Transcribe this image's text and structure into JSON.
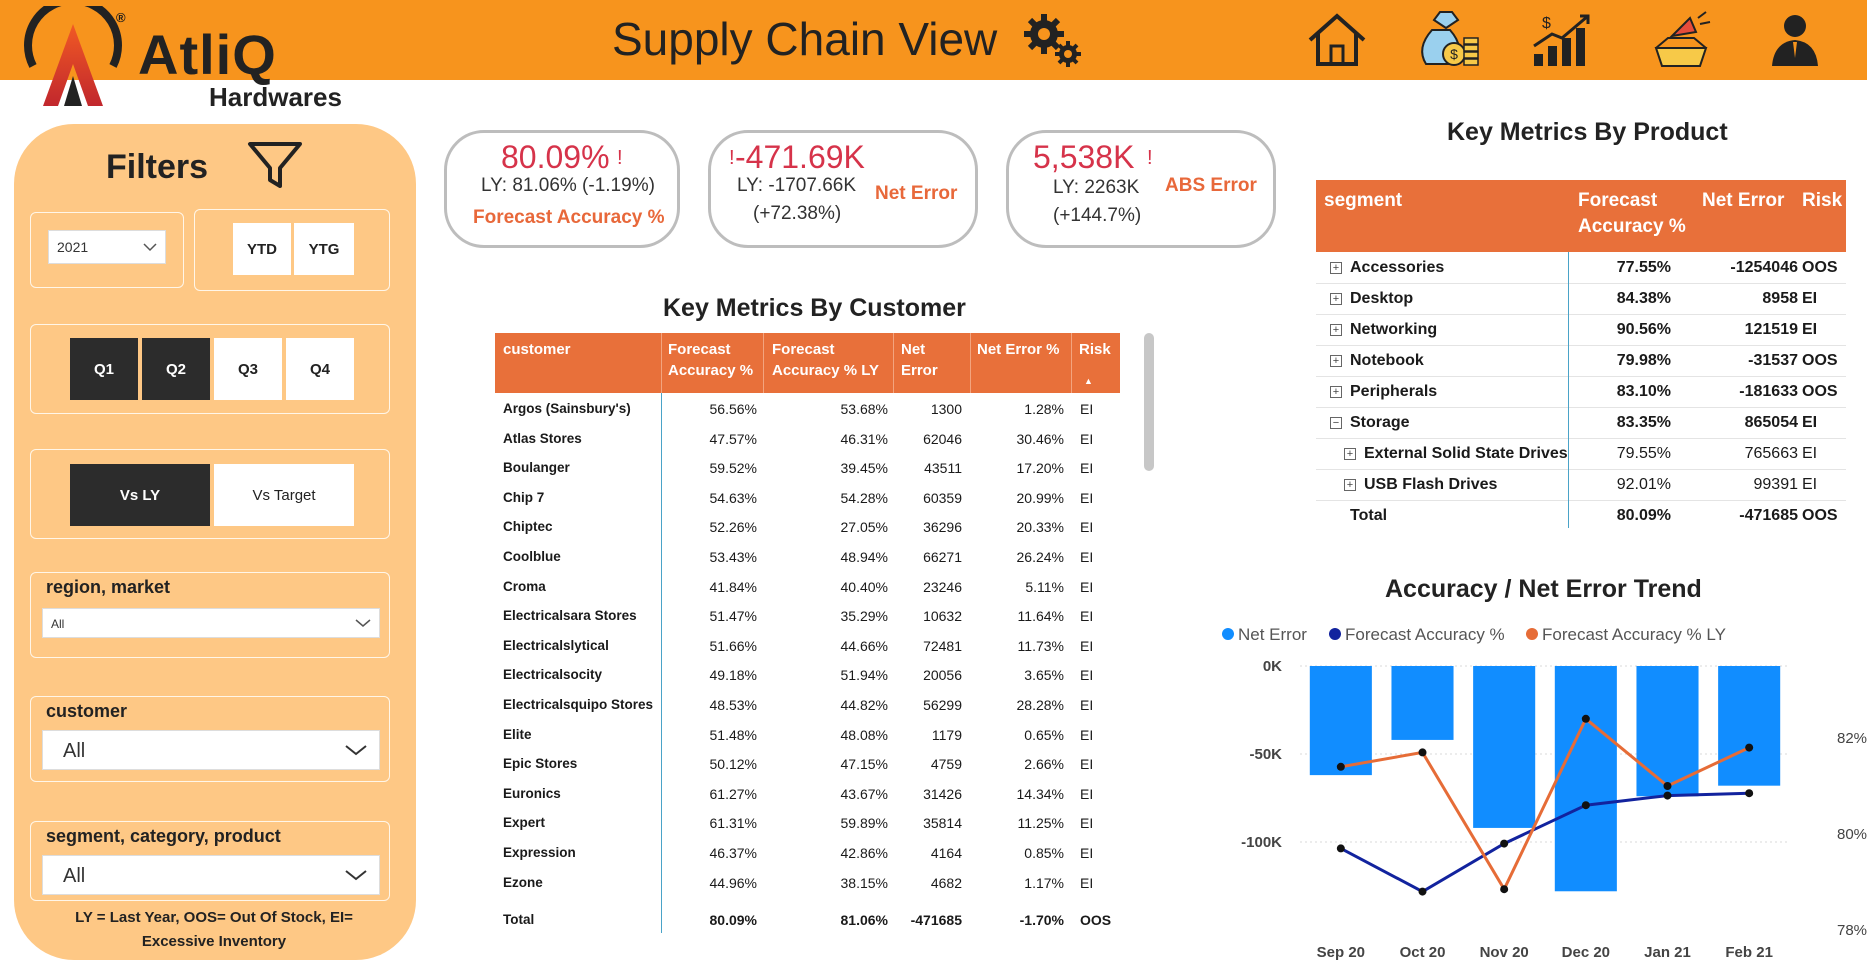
{
  "header": {
    "brand": "AtliQ",
    "brand_sub": "Hardwares",
    "reg_mark": "®",
    "title": "Supply Chain View",
    "icons": [
      "gear-icon",
      "home-icon",
      "money-bag-icon",
      "growth-chart-icon",
      "marketing-icon",
      "user-icon"
    ],
    "colors": {
      "bar": "#f7941d",
      "accent": "#e8703a",
      "kpi_red": "#d6334a"
    }
  },
  "filters": {
    "title": "Filters",
    "year": "2021",
    "ytd": "YTD",
    "ytg": "YTG",
    "quarters": [
      {
        "label": "Q1",
        "selected": true
      },
      {
        "label": "Q2",
        "selected": true
      },
      {
        "label": "Q3",
        "selected": false
      },
      {
        "label": "Q4",
        "selected": false
      }
    ],
    "vs_ly": "Vs LY",
    "vs_target": "Vs Target",
    "region_label": "region, market",
    "region_value": "All",
    "customer_label": "customer",
    "customer_value": "All",
    "segment_label": "segment, category, product",
    "segment_value": "All",
    "note_line1": "LY = Last Year, OOS= Out Of Stock, EI=",
    "note_line2": "Excessive Inventory"
  },
  "kpis": {
    "forecast": {
      "value": "80.09%",
      "flag": "!",
      "ly": "LY: 81.06% (-1.19%)",
      "label": "Forecast Accuracy %"
    },
    "net": {
      "value": "-471.69K",
      "flag": "!",
      "ly": "LY: -1707.66K",
      "change": "(+72.38%)",
      "label": "Net Error"
    },
    "abs": {
      "value": "5,538K",
      "flag": "!",
      "ly": "LY: 2263K",
      "change": "(+144.7%)",
      "label": "ABS Error"
    }
  },
  "customer_table": {
    "title": "Key Metrics By Customer",
    "headers": {
      "customer": "customer",
      "fa1": "Forecast",
      "fa2": "Accuracy %",
      "faly1": "Forecast",
      "faly2": "Accuracy % LY",
      "ne1": "Net",
      "ne2": "Error",
      "nep": "Net Error %",
      "risk": "Risk",
      "sort": "▲"
    },
    "rows": [
      [
        "Argos (Sainsbury's)",
        "56.56%",
        "53.68%",
        "1300",
        "1.28%",
        "EI"
      ],
      [
        "Atlas Stores",
        "47.57%",
        "46.31%",
        "62046",
        "30.46%",
        "EI"
      ],
      [
        "Boulanger",
        "59.52%",
        "39.45%",
        "43511",
        "17.20%",
        "EI"
      ],
      [
        "Chip 7",
        "54.63%",
        "54.28%",
        "60359",
        "20.99%",
        "EI"
      ],
      [
        "Chiptec",
        "52.26%",
        "27.05%",
        "36296",
        "20.33%",
        "EI"
      ],
      [
        "Coolblue",
        "53.43%",
        "48.94%",
        "66271",
        "26.24%",
        "EI"
      ],
      [
        "Croma",
        "41.84%",
        "40.40%",
        "23246",
        "5.11%",
        "EI"
      ],
      [
        "Electricalsara Stores",
        "51.47%",
        "35.29%",
        "10632",
        "11.64%",
        "EI"
      ],
      [
        "Electricalslytical",
        "51.66%",
        "44.66%",
        "72481",
        "11.73%",
        "EI"
      ],
      [
        "Electricalsocity",
        "49.18%",
        "51.94%",
        "20056",
        "3.65%",
        "EI"
      ],
      [
        "Electricalsquipo Stores",
        "48.53%",
        "44.82%",
        "56299",
        "28.28%",
        "EI"
      ],
      [
        "Elite",
        "51.48%",
        "48.08%",
        "1179",
        "0.65%",
        "EI"
      ],
      [
        "Epic Stores",
        "50.12%",
        "47.15%",
        "4759",
        "2.66%",
        "EI"
      ],
      [
        "Euronics",
        "61.27%",
        "43.67%",
        "31426",
        "14.34%",
        "EI"
      ],
      [
        "Expert",
        "61.31%",
        "59.89%",
        "35814",
        "11.25%",
        "EI"
      ],
      [
        "Expression",
        "46.37%",
        "42.86%",
        "4164",
        "0.85%",
        "EI"
      ],
      [
        "Ezone",
        "44.96%",
        "38.15%",
        "4682",
        "1.17%",
        "EI"
      ]
    ],
    "total": [
      "Total",
      "80.09%",
      "81.06%",
      "-471685",
      "-1.70%",
      "OOS"
    ]
  },
  "product_table": {
    "title": "Key Metrics By Product",
    "headers": {
      "segment": "segment",
      "fa1": "Forecast",
      "fa2": "Accuracy %",
      "ne": "Net Error",
      "risk": "Risk"
    },
    "rows": [
      {
        "name": "Accessories",
        "fa": "77.55%",
        "ne": "-1254046",
        "risk": "OOS",
        "level": 0,
        "box": "+"
      },
      {
        "name": "Desktop",
        "fa": "84.38%",
        "ne": "8958",
        "risk": "EI",
        "level": 0,
        "box": "+"
      },
      {
        "name": "Networking",
        "fa": "90.56%",
        "ne": "121519",
        "risk": "EI",
        "level": 0,
        "box": "+"
      },
      {
        "name": "Notebook",
        "fa": "79.98%",
        "ne": "-31537",
        "risk": "OOS",
        "level": 0,
        "box": "+"
      },
      {
        "name": "Peripherals",
        "fa": "83.10%",
        "ne": "-181633",
        "risk": "OOS",
        "level": 0,
        "box": "+"
      },
      {
        "name": "Storage",
        "fa": "83.35%",
        "ne": "865054",
        "risk": "EI",
        "level": 0,
        "box": "−"
      },
      {
        "name": "External Solid State Drives",
        "fa": "79.55%",
        "ne": "765663",
        "risk": "EI",
        "level": 1,
        "box": "+"
      },
      {
        "name": "USB Flash Drives",
        "fa": "92.01%",
        "ne": "99391",
        "risk": "EI",
        "level": 1,
        "box": "+"
      }
    ],
    "total": {
      "name": "Total",
      "fa": "80.09%",
      "ne": "-471685",
      "risk": "OOS"
    }
  },
  "chart_data": {
    "type": "bar",
    "title": "Accuracy / Net Error Trend",
    "categories": [
      "Sep 20",
      "Oct 20",
      "Nov 20",
      "Dec 20",
      "Jan 21",
      "Feb 21"
    ],
    "series": [
      {
        "name": "Net Error",
        "kind": "bar",
        "axis": "left",
        "color": "#118dff",
        "values": [
          -62000,
          -42000,
          -92000,
          -128000,
          -74000,
          -68000
        ]
      },
      {
        "name": "Forecast Accuracy %",
        "kind": "line",
        "axis": "right",
        "color": "#12239e",
        "values": [
          79.7,
          78.8,
          79.8,
          80.6,
          80.8,
          80.85
        ]
      },
      {
        "name": "Forecast Accuracy % LY",
        "kind": "line",
        "axis": "right",
        "color": "#e66c37",
        "values": [
          81.4,
          81.7,
          78.85,
          82.4,
          81.0,
          81.8
        ]
      }
    ],
    "left_ticks": [
      "0K",
      "-50K",
      "-100K"
    ],
    "right_ticks": [
      "82%",
      "80%",
      "78%"
    ],
    "ylim_left": [
      -150000,
      0
    ],
    "ylim_right": [
      78,
      83.5
    ],
    "legend_position": "top-left"
  }
}
